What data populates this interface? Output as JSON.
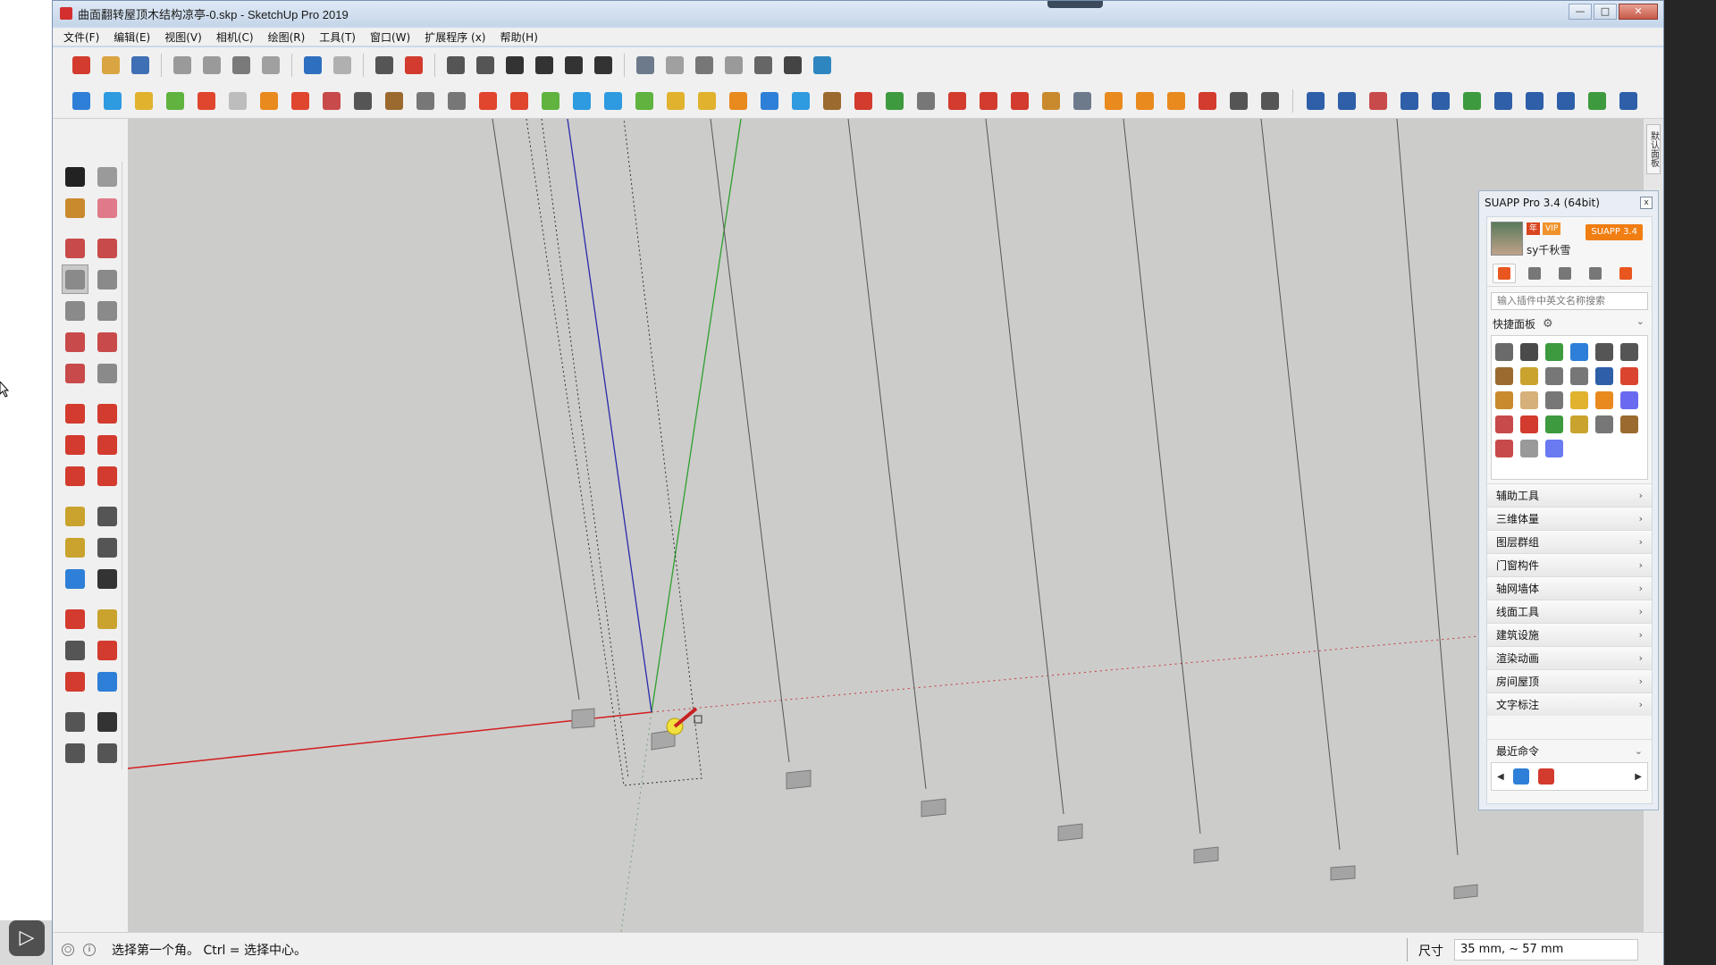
{
  "window": {
    "title": "曲面翻转屋顶木结构凉亭-0.skp - SketchUp Pro 2019",
    "controls": {
      "minimize": "—",
      "maximize": "□",
      "close": "✕"
    }
  },
  "menu": [
    "文件(F)",
    "编辑(E)",
    "视图(V)",
    "相机(C)",
    "绘图(R)",
    "工具(T)",
    "窗口(W)",
    "扩展程序 (x)",
    "帮助(H)"
  ],
  "toolbar_row1": [
    {
      "name": "sketchup-logo-icon",
      "color": "#d23b2e"
    },
    {
      "name": "open-icon",
      "color": "#d9a441"
    },
    {
      "name": "save-icon",
      "color": "#3f6fb5"
    },
    {
      "sep": true
    },
    {
      "name": "cut-icon",
      "color": "#9a9a9a"
    },
    {
      "name": "copy-icon",
      "color": "#9a9a9a"
    },
    {
      "name": "paste-icon",
      "color": "#7a7a7a"
    },
    {
      "name": "erase-icon",
      "color": "#a0a0a0"
    },
    {
      "sep": true
    },
    {
      "name": "undo-icon",
      "color": "#2f6fc0"
    },
    {
      "name": "redo-icon",
      "color": "#b0b0b0"
    },
    {
      "sep": true
    },
    {
      "name": "print-icon",
      "color": "#555555"
    },
    {
      "name": "model-info-icon",
      "color": "#d23b2e"
    },
    {
      "sep": true
    },
    {
      "name": "iso-view-icon",
      "color": "#555555"
    },
    {
      "name": "top-view-icon",
      "color": "#555555"
    },
    {
      "name": "front-view-icon",
      "color": "#333333"
    },
    {
      "name": "right-view-icon",
      "color": "#333333"
    },
    {
      "name": "back-view-icon",
      "color": "#333333"
    },
    {
      "name": "left-view-icon",
      "color": "#333333"
    },
    {
      "sep": true
    },
    {
      "name": "xray-icon",
      "color": "#6c7a8c"
    },
    {
      "name": "back-edges-icon",
      "color": "#a0a0a0"
    },
    {
      "name": "wireframe-icon",
      "color": "#777777"
    },
    {
      "name": "hidden-line-icon",
      "color": "#9a9a9a"
    },
    {
      "name": "shaded-icon",
      "color": "#666666"
    },
    {
      "name": "shaded-textures-icon",
      "color": "#444444"
    },
    {
      "name": "monochrome-icon",
      "color": "#2e86c1"
    }
  ],
  "toolbar_row2": [
    {
      "name": "suapp-blue-cube-icon",
      "color": "#2e7fd8"
    },
    {
      "name": "suapp-blue-plane-icon",
      "color": "#2e9ae0"
    },
    {
      "name": "suapp-yellow-plane-icon",
      "color": "#e0b22e"
    },
    {
      "name": "suapp-green-plane-icon",
      "color": "#5fb33e"
    },
    {
      "name": "suapp-red-plane-icon",
      "color": "#e0452e"
    },
    {
      "name": "suapp-outline-plane-icon",
      "color": "#bdbdbd"
    },
    {
      "name": "suapp-rotate-orange-icon",
      "color": "#e98a1f"
    },
    {
      "name": "suapp-red-square-icon",
      "color": "#e0452e"
    },
    {
      "name": "suapp-grid-red-icon",
      "color": "#c94a4a"
    },
    {
      "name": "suapp-door-icon",
      "color": "#555555"
    },
    {
      "name": "suapp-box-brown-icon",
      "color": "#9b6a2e"
    },
    {
      "name": "suapp-pipe-icon",
      "color": "#777777"
    },
    {
      "name": "suapp-stair-icon",
      "color": "#777777"
    },
    {
      "name": "suapp-curve-red-icon",
      "color": "#e0452e"
    },
    {
      "name": "suapp-move-red-icon",
      "color": "#e0452e"
    },
    {
      "name": "suapp-move-green-icon",
      "color": "#5fb33e"
    },
    {
      "name": "suapp-cross-blue-icon",
      "color": "#2e9ae0"
    },
    {
      "name": "suapp-cone-blue-icon",
      "color": "#2e9ae0"
    },
    {
      "name": "suapp-cone-green-icon",
      "color": "#5fb33e"
    },
    {
      "name": "suapp-cone-yellow-icon",
      "color": "#e0b22e"
    },
    {
      "name": "suapp-spiral-yellow-icon",
      "color": "#e0b22e"
    },
    {
      "name": "suapp-spiral-orange-icon",
      "color": "#e98a1f"
    },
    {
      "name": "suapp-spiral-blue-icon",
      "color": "#2e7fd8"
    },
    {
      "name": "suapp-star-blue-icon",
      "color": "#2e9ae0"
    },
    {
      "name": "suapp-cup-icon",
      "color": "#9b6a2e"
    },
    {
      "name": "suapp-u-red-icon",
      "color": "#d23b2e"
    },
    {
      "name": "suapp-tree-green-icon",
      "color": "#3e9a3e"
    },
    {
      "name": "suapp-export-icon",
      "color": "#777777"
    },
    {
      "name": "suapp-red-arrows-icon",
      "color": "#d23b2e"
    },
    {
      "name": "suapp-arrows-mixed-icon",
      "color": "#d23b2e"
    },
    {
      "name": "suapp-gem-red-icon",
      "color": "#d23b2e"
    },
    {
      "name": "suapp-cluster-icon",
      "color": "#c98a2e"
    },
    {
      "name": "suapp-frame-icon",
      "color": "#6c7a8c"
    },
    {
      "name": "suapp-grid-orange-icon",
      "color": "#e98a1f"
    },
    {
      "name": "suapp-grid-orange-2-icon",
      "color": "#e98a1f"
    },
    {
      "name": "suapp-grid-orange-3-icon",
      "color": "#e98a1f"
    },
    {
      "name": "suapp-scatter-icon",
      "color": "#d23b2e"
    },
    {
      "name": "suapp-lasso-icon",
      "color": "#555555"
    },
    {
      "name": "suapp-layout-icon",
      "color": "#555555"
    },
    {
      "sep": true
    },
    {
      "name": "curve-arc-icon",
      "color": "#2e5fa8"
    },
    {
      "name": "curve-n-icon",
      "color": "#2e5fa8"
    },
    {
      "name": "curve-zigzag-icon",
      "color": "#c94a4a"
    },
    {
      "name": "curve-wave-icon",
      "color": "#2e5fa8"
    },
    {
      "name": "curve-x-icon",
      "color": "#2e5fa8"
    },
    {
      "name": "curve-arc-green-icon",
      "color": "#3e9a3e"
    },
    {
      "name": "curve-square-icon",
      "color": "#2e5fa8"
    },
    {
      "name": "curve-spiral-icon",
      "color": "#2e5fa8"
    },
    {
      "name": "curve-arc2-icon",
      "color": "#2e5fa8"
    },
    {
      "name": "curve-s-green-icon",
      "color": "#3e9a3e"
    },
    {
      "name": "curve-hook-icon",
      "color": "#2e5fa8"
    }
  ],
  "left_tools": [
    {
      "name": "select-icon",
      "color": "#222222"
    },
    {
      "name": "make-component-icon",
      "color": "#9a9a9a"
    },
    {
      "name": "paint-bucket-icon",
      "color": "#c98a2e"
    },
    {
      "name": "eraser-icon",
      "color": "#e07a8a"
    },
    {
      "gap": true
    },
    {
      "name": "pencil-icon",
      "color": "#c94a4a"
    },
    {
      "name": "freehand-icon",
      "color": "#c94a4a"
    },
    {
      "name": "rectangle-icon",
      "color": "#8a8a8a",
      "active": true
    },
    {
      "name": "rotated-rectangle-icon",
      "color": "#8a8a8a"
    },
    {
      "name": "circle-icon",
      "color": "#8a8a8a"
    },
    {
      "name": "polygon-icon",
      "color": "#8a8a8a"
    },
    {
      "name": "arc-icon",
      "color": "#c94a4a"
    },
    {
      "name": "two-point-arc-icon",
      "color": "#c94a4a"
    },
    {
      "name": "three-point-arc-icon",
      "color": "#c94a4a"
    },
    {
      "name": "pie-icon",
      "color": "#8a8a8a"
    },
    {
      "gap": true
    },
    {
      "name": "move-icon",
      "color": "#d23b2e"
    },
    {
      "name": "push-pull-icon",
      "color": "#d23b2e"
    },
    {
      "name": "rotate-icon",
      "color": "#d23b2e"
    },
    {
      "name": "follow-me-icon",
      "color": "#d23b2e"
    },
    {
      "name": "scale-icon",
      "color": "#d23b2e"
    },
    {
      "name": "offset-icon",
      "color": "#d23b2e"
    },
    {
      "gap": true
    },
    {
      "name": "tape-measure-icon",
      "color": "#c9a32e"
    },
    {
      "name": "dimension-icon",
      "color": "#555555"
    },
    {
      "name": "protractor-icon",
      "color": "#c9a32e"
    },
    {
      "name": "text-icon",
      "color": "#555555"
    },
    {
      "name": "axes-icon",
      "color": "#2e7fd8"
    },
    {
      "name": "3d-text-icon",
      "color": "#333333"
    },
    {
      "gap": true
    },
    {
      "name": "orbit-icon",
      "color": "#d23b2e"
    },
    {
      "name": "pan-icon",
      "color": "#c9a32e"
    },
    {
      "name": "zoom-icon",
      "color": "#555555"
    },
    {
      "name": "zoom-window-icon",
      "color": "#d23b2e"
    },
    {
      "name": "zoom-extents-icon",
      "color": "#d23b2e"
    },
    {
      "name": "previous-view-icon",
      "color": "#2e7fd8"
    },
    {
      "gap": true
    },
    {
      "name": "position-camera-icon",
      "color": "#555555"
    },
    {
      "name": "look-around-icon",
      "color": "#333333"
    },
    {
      "name": "walk-icon",
      "color": "#555555"
    },
    {
      "name": "section-plane-icon",
      "color": "#555555"
    }
  ],
  "right_tray_tab": "默认面板",
  "suapp": {
    "title": "SUAPP Pro 3.4 (64bit)",
    "close": "x",
    "badge_year": "年",
    "badge_vip": "VIP",
    "plan": "SUAPP 3.4",
    "username": "sy千秋雪",
    "search_placeholder": "输入插件中英文名称搜索",
    "quick_panel": "快捷面板",
    "quick_chevron": "⌄",
    "tab_icons": [
      {
        "name": "home-icon",
        "color": "#e9561f",
        "active": true
      },
      {
        "name": "layers-icon",
        "color": "#777777"
      },
      {
        "name": "user-icon",
        "color": "#777777"
      },
      {
        "name": "search-icon",
        "color": "#777777"
      },
      {
        "name": "list-icon",
        "color": "#e9561f"
      }
    ],
    "quick_icons": [
      "#6a6a6a",
      "#4a4a4a",
      "#3e9a3e",
      "#2e7fd8",
      "#555555",
      "#555555",
      "#9b6a2e",
      "#c9a32e",
      "#777777",
      "#777777",
      "#2e5fa8",
      "#d9452e",
      "#c98a2e",
      "#d6b07a",
      "#777777",
      "#e0b22e",
      "#e98a1f",
      "#6a6af0",
      "#c94a4a",
      "#d23b2e",
      "#3e9a3e",
      "#c9a32e",
      "#777777",
      "#9b6a2e",
      "#c94a4a",
      "#999999",
      "#6a7af0"
    ],
    "categories": [
      "辅助工具",
      "三维体量",
      "图层群组",
      "门窗构件",
      "轴网墙体",
      "线面工具",
      "建筑设施",
      "渲染动画",
      "房间屋顶",
      "文字标注"
    ],
    "recent_label": "最近命令",
    "recent_icons": [
      {
        "name": "recent-blue-icon",
        "color": "#2e7fd8"
      },
      {
        "name": "recent-red-icon",
        "color": "#d23b2e"
      }
    ]
  },
  "status": {
    "message": "选择第一个角。  Ctrl = 选择中心。",
    "measure_label": "尺寸",
    "measure_value": "35 mm, ~ 57 mm"
  },
  "corner_logo": "▷"
}
